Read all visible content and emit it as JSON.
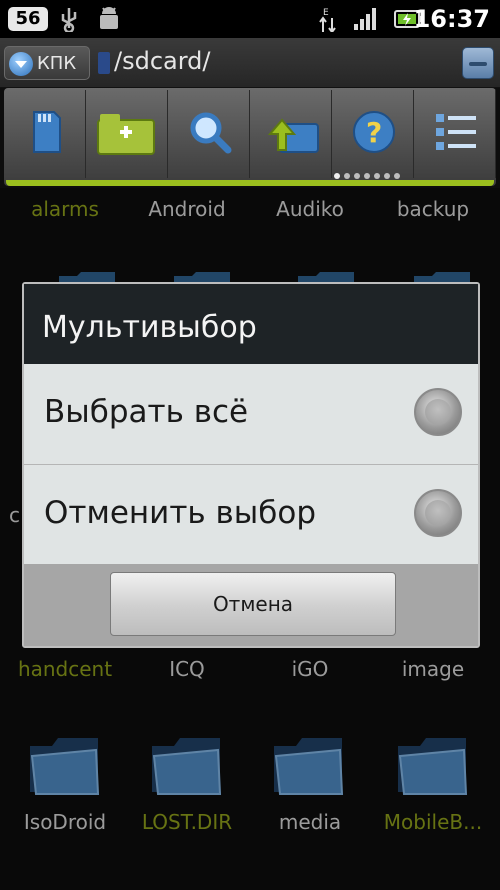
{
  "statusbar": {
    "badge": "56",
    "icons": [
      "usb-icon",
      "android-debug-icon",
      "data-transfer-icon",
      "signal-icon",
      "battery-icon"
    ],
    "time": "16:37"
  },
  "pathbar": {
    "dropdown_label": "КПК",
    "path": "/sdcard/"
  },
  "toolbar": {
    "buttons": [
      "sdcard-icon",
      "new-folder-icon",
      "search-icon",
      "up-folder-icon",
      "help-icon",
      "list-view-icon"
    ],
    "accent": "#9bbf1e"
  },
  "files": {
    "row1": [
      "alarms",
      "Android",
      "Audiko",
      "backup"
    ],
    "row3": [
      "handcent",
      "ICQ",
      "iGO",
      "image"
    ],
    "row4": [
      "IsoDroid",
      "LOST.DIR",
      "media",
      "MobileB..."
    ],
    "partial_left": "c"
  },
  "dialog": {
    "title": "Мультивыбор",
    "options": [
      "Выбрать всё",
      "Отменить выбор"
    ],
    "cancel": "Отмена"
  }
}
